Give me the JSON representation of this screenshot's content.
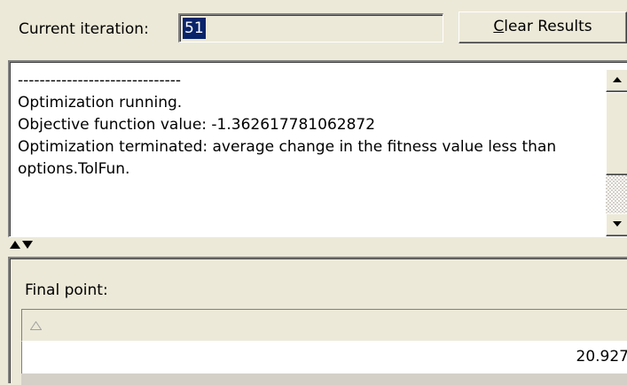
{
  "toolbar": {
    "iteration_label": "Current iteration:",
    "iteration_value": "51",
    "clear_button": {
      "prefix": "",
      "mnemonic": "C",
      "rest": "lear Results"
    }
  },
  "results": {
    "lines": [
      "------------------------------",
      "Optimization running.",
      "Objective function value: -1.362617781062872",
      "Optimization terminated: average change in the fitness value less than options.TolFun."
    ]
  },
  "final_point": {
    "label": "Final point:",
    "sort_icon": "sort-triangle-icon",
    "values": [
      "20.927"
    ]
  },
  "colors": {
    "panel_bg": "#ece9d8",
    "selection_bg": "#0a246a",
    "selection_fg": "#ffffff"
  }
}
